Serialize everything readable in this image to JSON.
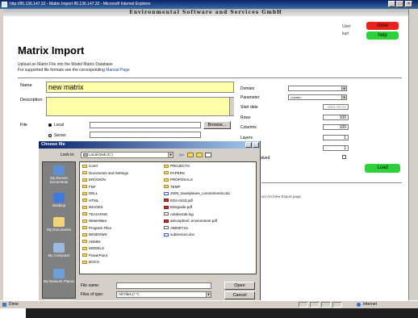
{
  "window": {
    "title": "http://86.136.147.32 - Matrix Import 86.136.147.32 - Microsoft Internet Explorer",
    "min": "_",
    "max": "□",
    "close": "×"
  },
  "header": {
    "company": "Environmental Software and Services GmbH",
    "user_label": "User",
    "user_name": "kurt",
    "close_label": "close",
    "help_label": "help",
    "close_color": "#e8231d",
    "help_color": "#2fd13b"
  },
  "page": {
    "title": "Matrix Import",
    "intro_line1": "Upload an Matrix File into the Model Matrix Database",
    "intro_line2_prefix": "For supported file formats see the corresponding ",
    "intro_link": "Manual Page"
  },
  "form": {
    "name_label": "Name",
    "name_value": "new matrix",
    "description_label": "Description",
    "file_label": "File",
    "radio_local": "Local",
    "radio_server": "Server",
    "browse_label": "Browse...",
    "domain_label": "Domain",
    "parameter_label": "Parameter",
    "parameter_value": "<none>",
    "start_date_label": "Start date",
    "start_date_value": "2001-01-01",
    "rows_label": "Rows",
    "rows_value": "100",
    "columns_label": "Columns",
    "columns_value": "100",
    "layers_label": "Layers",
    "layers_value": "1",
    "s_label": "s",
    "s_value": "1",
    "valued_label": "alued",
    "load_label": "Load",
    "load_color": "#2fd13b",
    "footer_link": "uct ArcView Export page"
  },
  "dialog": {
    "title": "Choose file",
    "help": "?",
    "close": "×",
    "look_in_label": "Look in:",
    "look_in_value": "Local Disk (C:)",
    "places": [
      "My Recent Documents",
      "Desktop",
      "My Documents",
      "My Computer",
      "My Network Places"
    ],
    "files_col1": [
      {
        "name": "Corel",
        "type": "folder"
      },
      {
        "name": "Documents and Settings",
        "type": "folder"
      },
      {
        "name": "EROSION",
        "type": "folder"
      },
      {
        "name": "FDF",
        "type": "folder"
      },
      {
        "name": "DELL",
        "type": "folder"
      },
      {
        "name": "HTML",
        "type": "folder"
      },
      {
        "name": "IMAGES",
        "type": "folder"
      },
      {
        "name": "TEACHING",
        "type": "folder"
      },
      {
        "name": "WaterWare",
        "type": "folder"
      },
      {
        "name": "Program Files",
        "type": "folder"
      },
      {
        "name": "WINDOWS",
        "type": "folder"
      },
      {
        "name": "ADMIN",
        "type": "folder"
      },
      {
        "name": "MODELS",
        "type": "folder"
      },
      {
        "name": "PowerPoint",
        "type": "folder"
      },
      {
        "name": "DOCS",
        "type": "folder"
      }
    ],
    "files_col2": [
      {
        "name": "PROJECTS",
        "type": "folder"
      },
      {
        "name": "PAPERS",
        "type": "folder"
      },
      {
        "name": "PROPOSALS",
        "type": "folder"
      },
      {
        "name": "TEMP",
        "type": "folder"
      },
      {
        "name": "2009_travelplanes_commitments.doc",
        "type": "doc"
      },
      {
        "name": "ED4-0433.pdf",
        "type": "pdf"
      },
      {
        "name": "EDsguide.pdf",
        "type": "pdf"
      },
      {
        "name": "Adobectab.log",
        "type": "txt"
      },
      {
        "name": "atmospheric environment.pdf",
        "type": "pdf"
      },
      {
        "name": "ABINET.txt",
        "type": "txt"
      },
      {
        "name": "subsectors.doc",
        "type": "doc"
      }
    ],
    "file_name_label": "File name:",
    "file_name_value": "",
    "file_type_label": "Files of type:",
    "file_type_value": "All Files (*.*)",
    "open_label": "Open",
    "cancel_label": "Cancel"
  },
  "status": {
    "left": "Done",
    "zone": "Internet"
  }
}
